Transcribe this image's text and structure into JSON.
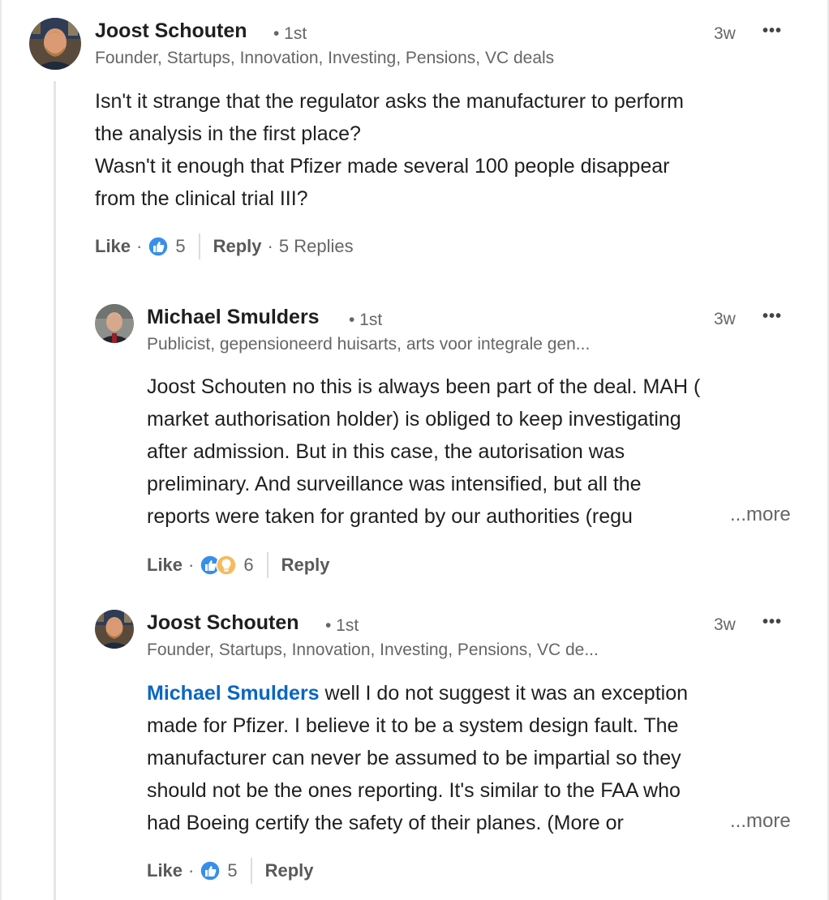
{
  "comments": [
    {
      "author": "Joost Schouten",
      "degree": "• 1st",
      "headline": "Founder, Startups, Innovation, Investing, Pensions, VC deals",
      "time": "3w",
      "body_lines": [
        "Isn't it strange that the regulator asks the manufacturer to perform",
        "the analysis in the first place?",
        "Wasn't it enough that Pfizer made several 100 people disappear",
        "from the clinical trial III?"
      ],
      "like_label": "Like",
      "reaction_icons": [
        "like-icon"
      ],
      "reaction_count": "5",
      "reply_label": "Reply",
      "replies_label": "5 Replies"
    },
    {
      "author": "Michael Smulders",
      "degree": "• 1st",
      "headline": "Publicist, gepensioneerd huisarts, arts voor integrale gen...",
      "time": "3w",
      "body_lines": [
        "Joost Schouten no this is always been part of the deal. MAH (",
        "market authorisation holder) is obliged to keep investigating",
        "after admission. But in this case, the autorisation was",
        "preliminary. And surveillance was intensified, but all the",
        "reports were taken for granted by our authorities (regu"
      ],
      "more_label": "...more",
      "like_label": "Like",
      "reaction_icons": [
        "like-icon",
        "insightful-icon"
      ],
      "reaction_count": "6",
      "reply_label": "Reply"
    },
    {
      "author": "Joost Schouten",
      "degree": "• 1st",
      "headline": "Founder, Startups, Innovation, Investing, Pensions, VC de...",
      "time": "3w",
      "mention": "Michael Smulders",
      "body_first_rest": " well I do not suggest it was an exception",
      "body_lines": [
        "made for Pfizer. I believe it to be a system design fault. The",
        "manufacturer can never be assumed to be impartial so they",
        "should not be the ones reporting. It's similar to the FAA who",
        "had Boeing certify the safety of their planes. (More or"
      ],
      "more_label": "...more",
      "like_label": "Like",
      "reaction_icons": [
        "like-icon"
      ],
      "reaction_count": "5",
      "reply_label": "Reply"
    }
  ],
  "colors": {
    "like_blue": "#378fe9",
    "insightful_yellow": "#f5bb5c",
    "mention_blue": "#0a66c2",
    "muted_text": "#666666"
  }
}
